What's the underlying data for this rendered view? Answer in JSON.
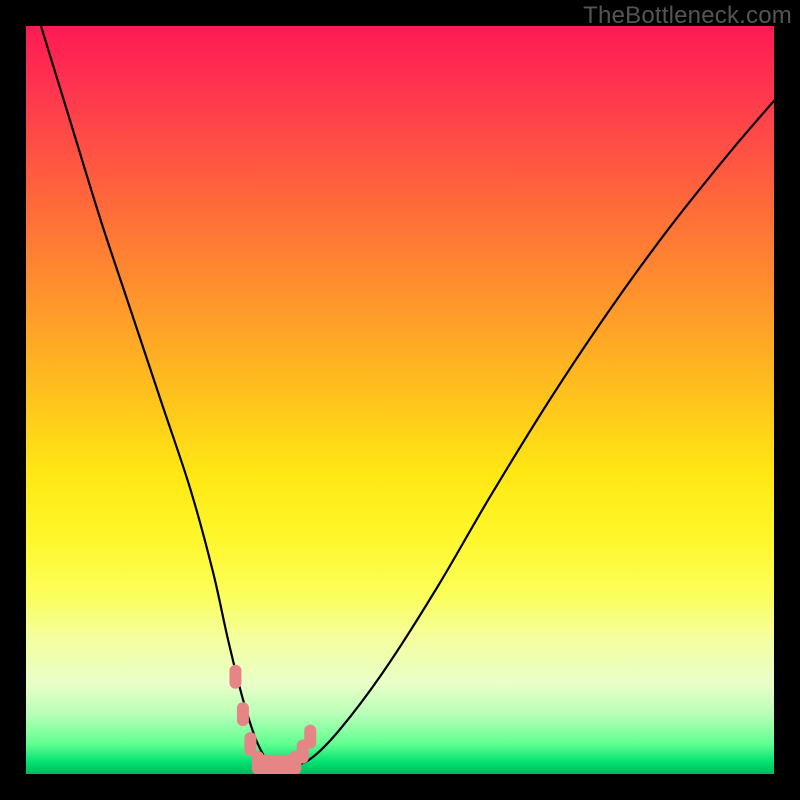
{
  "watermark": "TheBottleneck.com",
  "chart_data": {
    "type": "line",
    "title": "",
    "xlabel": "",
    "ylabel": "",
    "xlim": [
      0,
      100
    ],
    "ylim": [
      0,
      100
    ],
    "grid": false,
    "color_scale": {
      "orientation": "vertical",
      "stops": [
        {
          "pos": 0,
          "color": "#ff1a55",
          "meaning": "high"
        },
        {
          "pos": 50,
          "color": "#ffe814",
          "meaning": "mid"
        },
        {
          "pos": 100,
          "color": "#00b860",
          "meaning": "low"
        }
      ]
    },
    "series": [
      {
        "name": "bottleneck-curve",
        "color": "#000000",
        "x": [
          2,
          6,
          10,
          14,
          18,
          22,
          25,
          27,
          29,
          31,
          33,
          35,
          38,
          42,
          48,
          55,
          62,
          70,
          78,
          86,
          94,
          100
        ],
        "y": [
          100,
          87,
          74,
          62,
          50,
          38,
          27,
          18,
          10,
          4,
          1,
          1,
          2,
          6,
          14,
          25,
          37,
          50,
          62,
          73,
          83,
          90
        ]
      }
    ],
    "annotations": [
      {
        "name": "trough-marker",
        "type": "scatter",
        "color": "#e58585",
        "x": [
          28,
          29,
          30,
          31,
          32,
          33,
          34,
          35,
          36,
          37,
          38
        ],
        "y": [
          13,
          8,
          4,
          1.5,
          1,
          1,
          1,
          1,
          1.5,
          3,
          5
        ]
      }
    ]
  }
}
